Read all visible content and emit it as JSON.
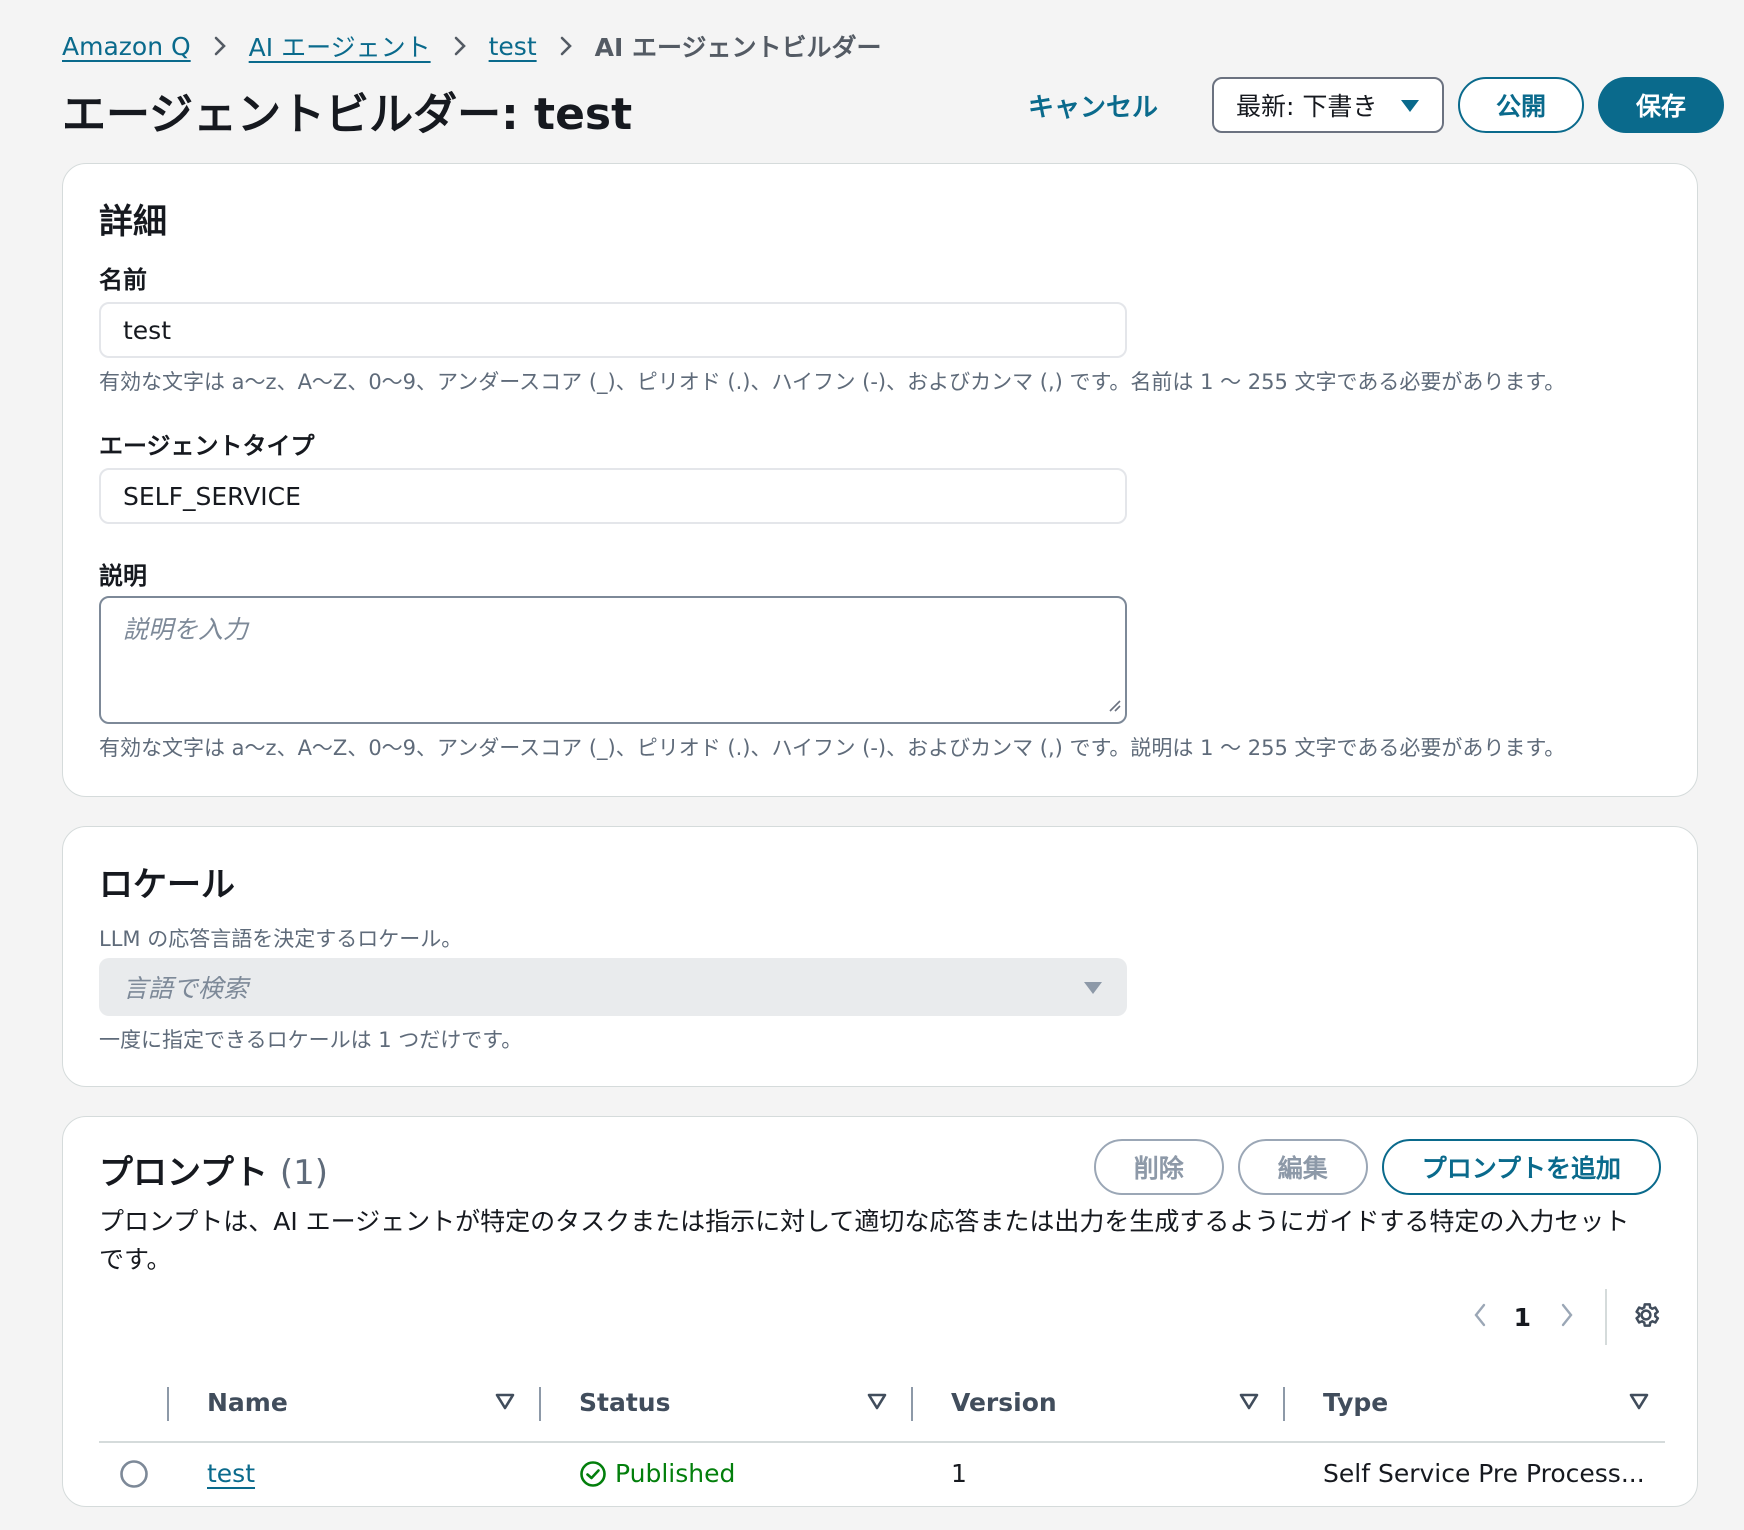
{
  "breadcrumb": {
    "items": [
      "Amazon Q",
      "AI エージェント",
      "test"
    ],
    "current": "AI エージェントビルダー"
  },
  "header": {
    "title": "エージェントビルダー: test",
    "cancel_label": "キャンセル",
    "version_select": "最新: 下書き",
    "publish_label": "公開",
    "save_label": "保存"
  },
  "details": {
    "title": "詳細",
    "name_label": "名前",
    "name_value": "test",
    "name_hint": "有効な文字は a〜z、A〜Z、0〜9、アンダースコア (_)、ピリオド (.)、ハイフン (-)、およびカンマ (,) です。名前は 1 〜 255 文字である必要があります。",
    "type_label": "エージェントタイプ",
    "type_value": "SELF_SERVICE",
    "desc_label": "説明",
    "desc_placeholder": "説明を入力",
    "desc_hint": "有効な文字は a〜z、A〜Z、0〜9、アンダースコア (_)、ピリオド (.)、ハイフン (-)、およびカンマ (,) です。説明は 1 〜 255 文字である必要があります。"
  },
  "locale": {
    "title": "ロケール",
    "description": "LLM の応答言語を決定するロケール。",
    "placeholder": "言語で検索",
    "hint": "一度に指定できるロケールは 1 つだけです。"
  },
  "prompts": {
    "title": "プロンプト",
    "count": "(1)",
    "delete_label": "削除",
    "edit_label": "編集",
    "add_label": "プロンプトを追加",
    "description_line1": "プロンプトは、AI エージェントが特定のタスクまたは指示に対して適切な応答または出力を生成するようにガイドする特定の入力セット",
    "description_line2": "です。",
    "page_number": "1",
    "columns": [
      "Name",
      "Status",
      "Version",
      "Type"
    ],
    "rows": [
      {
        "name": "test",
        "status": "Published",
        "version": "1",
        "type": "Self Service Pre Process..."
      }
    ]
  },
  "colors": {
    "accent": "#0a6a8c",
    "success": "#037f0c",
    "background": "#f4f4f4"
  },
  "icons": [
    "chevron-right-icon",
    "caret-down-icon",
    "sort-icon",
    "check-circle-icon",
    "gear-icon",
    "chevron-left-icon",
    "radio-icon",
    "resize-grip-icon"
  ]
}
